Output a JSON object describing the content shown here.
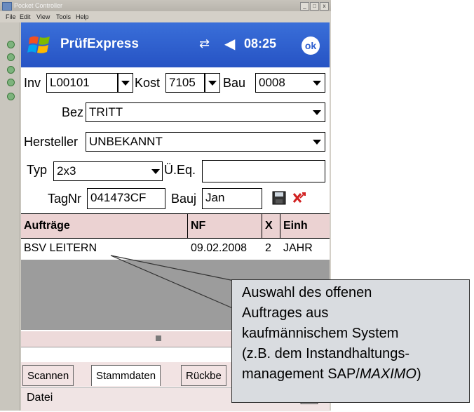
{
  "host_window": {
    "title": "Pocket Controller",
    "menu": [
      "File",
      "Edit",
      "View",
      "Tools",
      "Help"
    ],
    "min_label": "_",
    "max_label": "□",
    "close_label": "x"
  },
  "titlebar": {
    "app_title": "PrüfExpress",
    "time": "08:25",
    "ok_label": "ok",
    "sync_icon": "sync-arrows-icon",
    "volume_icon": "speaker-icon"
  },
  "form": {
    "inv_label": "Inv",
    "inv_value": "L00101",
    "kost_label": "Kost",
    "kost_value": "7105",
    "bau_label": "Bau",
    "bau_value": "0008",
    "bez_label": "Bez",
    "bez_value": "TRITT",
    "hersteller_label": "Hersteller",
    "hersteller_value": "UNBEKANNT",
    "typ_label": "Typ",
    "typ_value": "2x3",
    "ueq_label": "Ü.Eq.",
    "ueq_value": "",
    "tagnr_label": "TagNr",
    "tagnr_value": "041473CF",
    "bauj_label": "Bauj",
    "bauj_value": "Jan"
  },
  "grid": {
    "headers": [
      "Aufträge",
      "NF",
      "X",
      "Einh"
    ],
    "rows": [
      {
        "auftrag": "BSV LEITERN",
        "nf": "09.02.2008",
        "x": "2",
        "einh": "JAHR"
      }
    ]
  },
  "tabs": [
    "Scannen",
    "Stammdaten",
    "Rückbe"
  ],
  "active_tab": "Stammdaten",
  "menubar": {
    "datei": "Datei"
  },
  "callout": {
    "text": "Auswahl des offenen\nAuftrages aus\nkaufmännischem System\n(z.B. dem Instandhaltungs-\nmanagement SAP/MAXIMO)"
  },
  "colors": {
    "titlebar": "#2e5fcf",
    "grid_header": "#ebd2d2",
    "grid_empty": "#9c9c9c",
    "callout_bg": "#d9dce0"
  }
}
